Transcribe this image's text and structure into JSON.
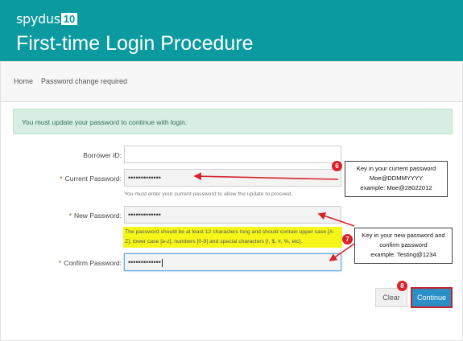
{
  "banner": {
    "brand": "spydus",
    "brand_badge": "10",
    "title": "First-time Login Procedure"
  },
  "breadcrumb": {
    "home": "Home",
    "current": "Password change required"
  },
  "alert": {
    "message": "You must update your password to continue with login."
  },
  "form": {
    "borrower_id": {
      "label": "Borrower ID:",
      "value": ""
    },
    "current_password": {
      "label": "Current Password:",
      "value": "•••••••••••••",
      "help": "You must enter your current password to allow the update to proceed."
    },
    "new_password": {
      "label": "New Password:",
      "value": "•••••••••••••",
      "help": "The password should be at least 12 characters long and should contain upper case [A-Z], lower case [a-z], numbers [0-9] and special characters [!, $, #, %, etc]."
    },
    "confirm_password": {
      "label": "Confirm Password:",
      "value": "•••••••••••••"
    },
    "required_marker": "*"
  },
  "buttons": {
    "clear": "Clear",
    "continue": "Continue"
  },
  "annotations": {
    "callout_current": {
      "line1": "Key in your current password",
      "line2": "Moe@DDMMYYYY",
      "line3": "example: Moe@28022012"
    },
    "callout_new": {
      "line1": "Key in your new password and",
      "line2": "confirm password",
      "line3": "example: Testing@1234"
    },
    "step6": "6",
    "step7": "7",
    "step8": "8"
  },
  "colors": {
    "banner": "#0b9a9f",
    "alert_bg": "#d7eee3",
    "highlight": "#f6f61a",
    "continue_button": "#2a8fc7",
    "annotation_red": "#d8232a"
  }
}
